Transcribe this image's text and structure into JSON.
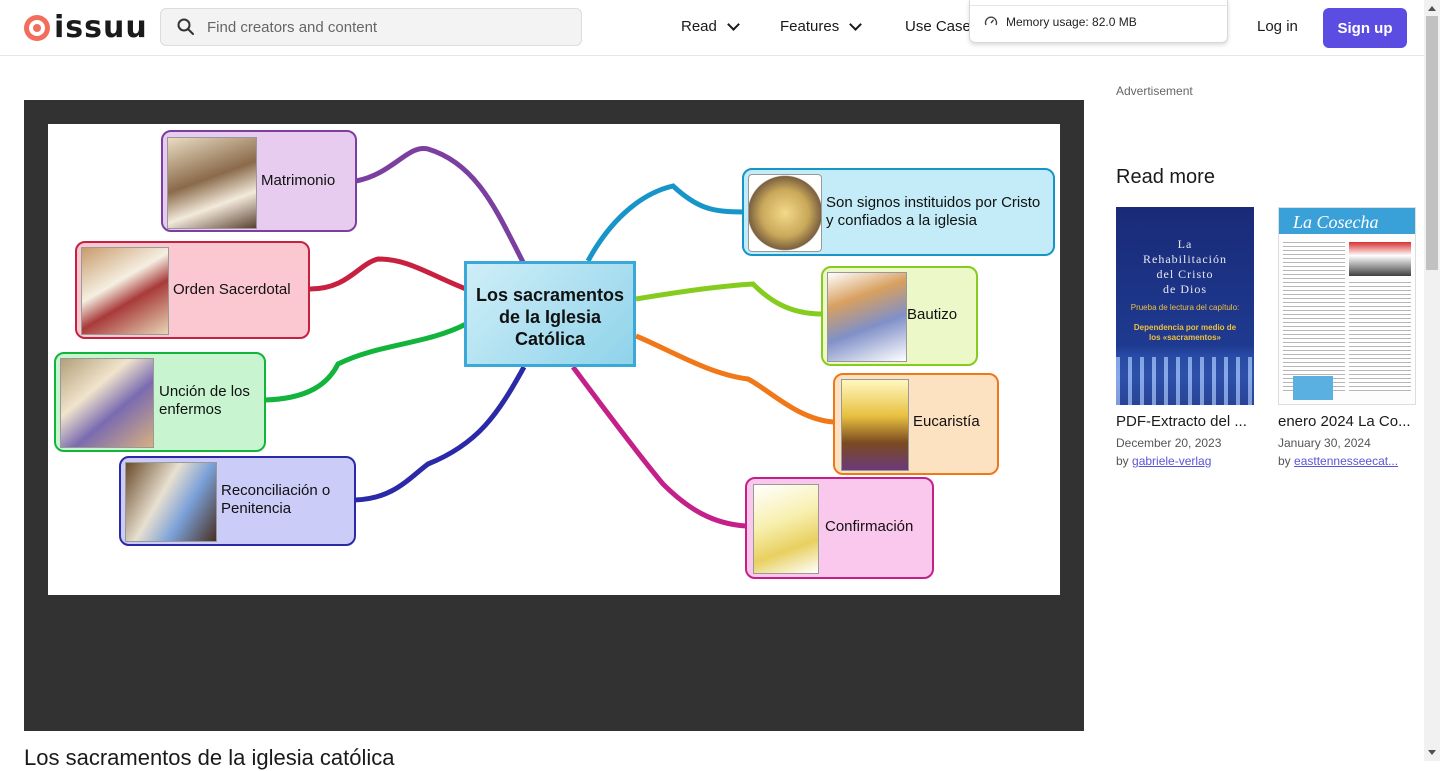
{
  "header": {
    "logo_text": "issuu",
    "search_placeholder": "Find creators and content",
    "nav": [
      {
        "label": "Read"
      },
      {
        "label": "Features"
      },
      {
        "label": "Use Case"
      }
    ],
    "memory_usage": "Memory usage: 82.0 MB",
    "login_label": "Log in",
    "signup_label": "Sign up"
  },
  "document": {
    "title": "Los sacramentos de la iglesia católica",
    "mindmap": {
      "center": "Los sacramentos de la Iglesia Católica",
      "left": [
        {
          "label": "Matrimonio",
          "color": "#7b3fa0",
          "fill": "#e8ccf0"
        },
        {
          "label": "Orden Sacerdotal",
          "color": "#c8203f",
          "fill": "#fbc7d1"
        },
        {
          "label": "Unción de los enfermos",
          "color": "#12b43c",
          "fill": "#c8f5d0"
        },
        {
          "label": "Reconciliación o Penitencia",
          "color": "#2a2aa8",
          "fill": "#ccccf8"
        }
      ],
      "right": [
        {
          "label": "Son signos instituidos por Cristo y confiados a la iglesia",
          "color": "#1795c8",
          "fill": "#c4ecf8"
        },
        {
          "label": "Bautizo",
          "color": "#86cc1e",
          "fill": "#edf8c8"
        },
        {
          "label": "Eucaristía",
          "color": "#f07818",
          "fill": "#fde2c2"
        },
        {
          "label": "Confirmación",
          "color": "#c4208a",
          "fill": "#f9c8ec"
        }
      ]
    }
  },
  "sidebar": {
    "advertisement": "Advertisement",
    "read_more": "Read more",
    "cards": [
      {
        "title": "PDF-Extracto del ...",
        "date": "December 20, 2023",
        "by": "by",
        "author": "gabriele-verlag",
        "cover_lines": [
          "La",
          "Rehabilitación",
          "del Cristo",
          "de Dios"
        ],
        "cover_sub": "Prueba de lectura del capítulo:",
        "cover_sub2": "Dependencia por medio de los «sacramentos»"
      },
      {
        "title": "enero 2024 La Co...",
        "date": "January 30, 2024",
        "by": "by",
        "author": "easttennesseecat...",
        "cover_title": "La Cosecha"
      }
    ]
  }
}
